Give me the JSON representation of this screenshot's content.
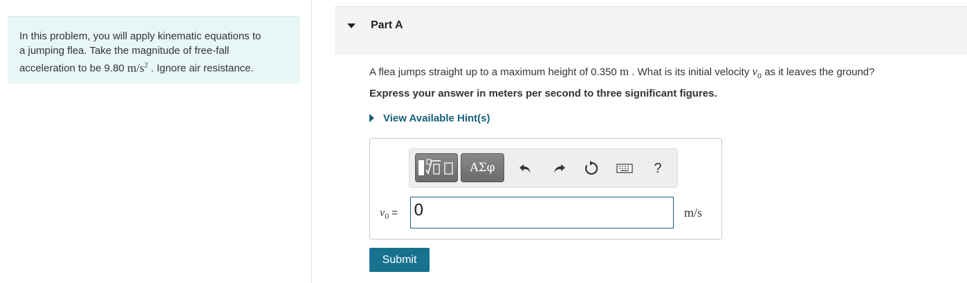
{
  "intro": {
    "line1": "In this problem, you will apply kinematic equations to",
    "line2": "a jumping flea. Take the magnitude of free-fall",
    "line3_prefix": "acceleration to be 9.80 ",
    "accel_unit": "m/s",
    "accel_exp": "2",
    "line3_suffix": " . Ignore air resistance."
  },
  "part": {
    "title": "Part A",
    "collapse_icon": "caret-down-icon"
  },
  "question": {
    "prefix": "A flea jumps straight up to a maximum height of 0.350 ",
    "height_unit": "m",
    "middle": " . What is its initial velocity ",
    "var": "v",
    "var_sub": "0",
    "suffix": " as it leaves the ground?"
  },
  "instruction": "Express your answer in meters per second to three significant figures.",
  "hint": {
    "label": "View Available Hint(s)",
    "icon": "caret-right-icon"
  },
  "toolbar": {
    "symbols_label": "ΑΣφ",
    "help_label": "?",
    "icons": [
      "templates-icon",
      "undo-icon",
      "redo-icon",
      "reset-icon",
      "keyboard-icon",
      "help-icon"
    ]
  },
  "answer": {
    "var": "v",
    "var_sub": "0",
    "equals": " =",
    "value": "0",
    "units": "m/s"
  },
  "submit_label": "Submit",
  "colors": {
    "accent": "#17607a",
    "button": "#17728f",
    "intro_bg": "#e8f6f6",
    "header_bg": "#f4f4f4"
  }
}
